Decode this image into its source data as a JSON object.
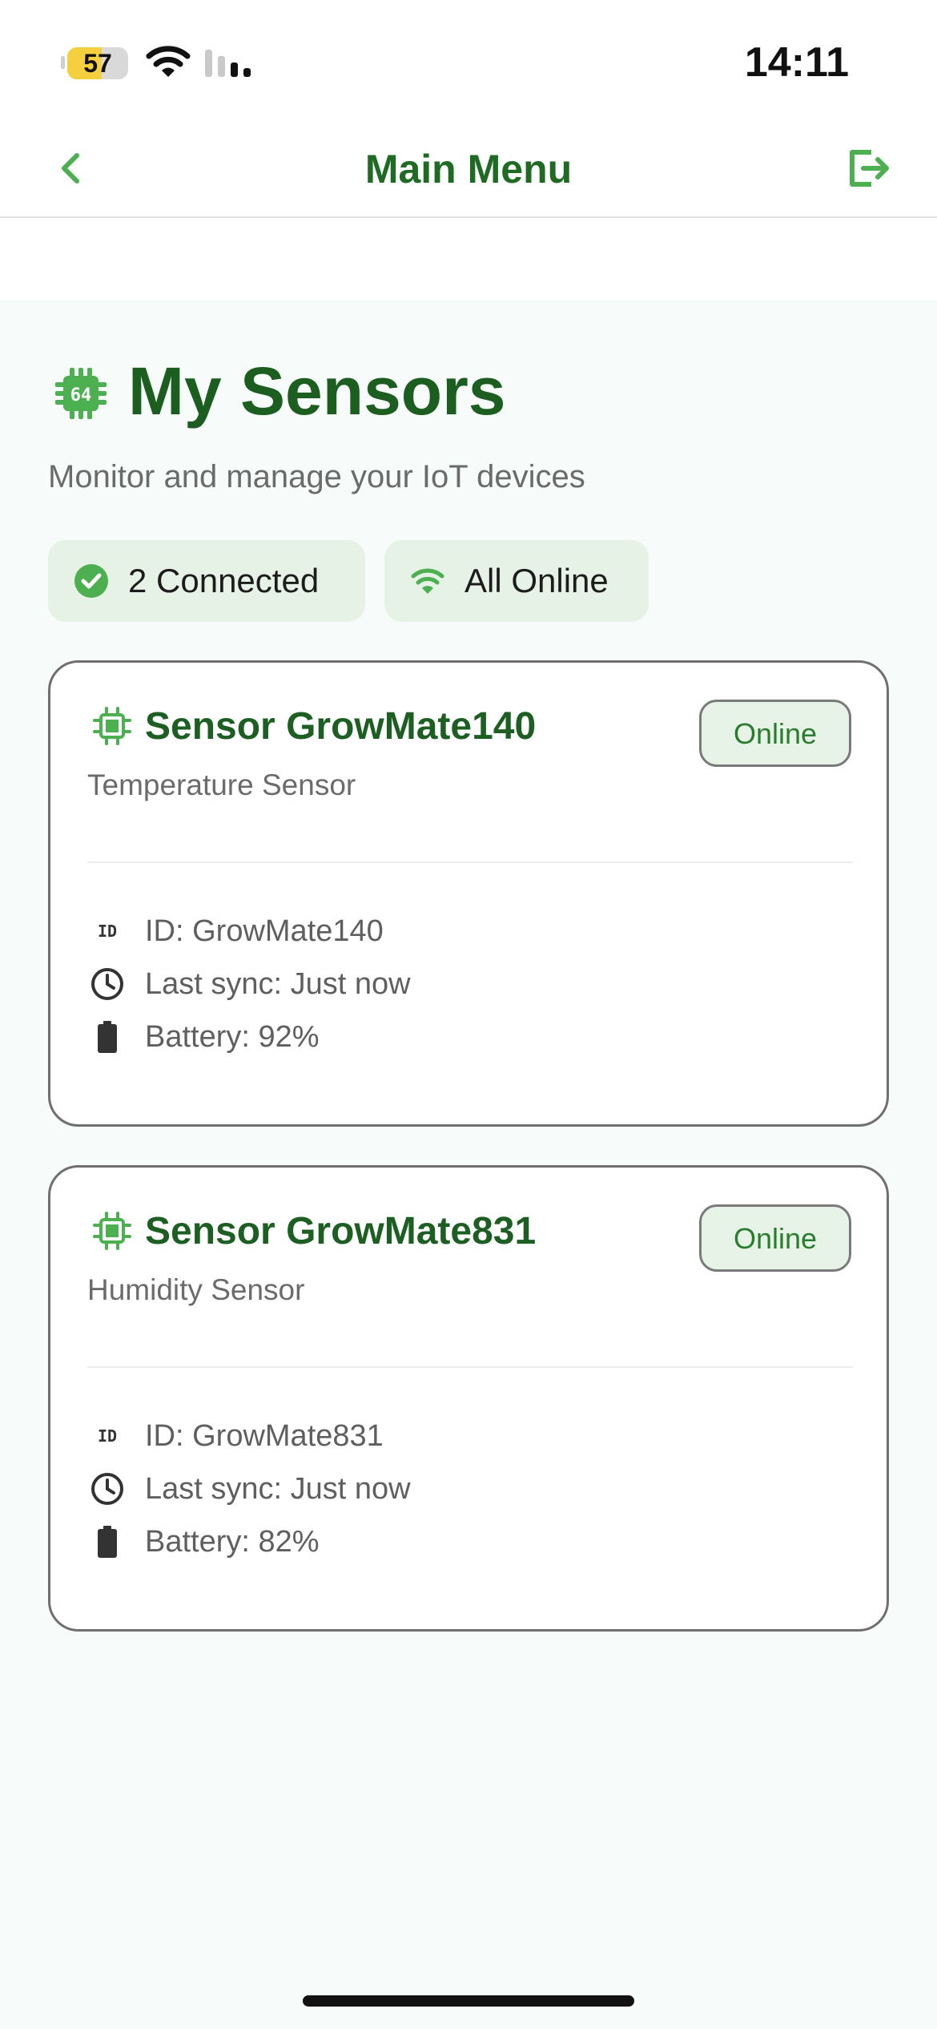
{
  "status_bar": {
    "battery_level": "57",
    "battery_fraction": 0.57,
    "time": "14:11"
  },
  "nav": {
    "back_icon": "chevron-left-icon",
    "title": "Main Menu",
    "logout_icon": "logout-icon"
  },
  "header": {
    "icon": "chip-icon",
    "title": "My Sensors",
    "subtitle": "Monitor and manage your IoT devices"
  },
  "chips": {
    "connected": {
      "icon": "check-circle-icon",
      "label": "2 Connected"
    },
    "online": {
      "icon": "wifi-icon",
      "label": "All Online"
    }
  },
  "sensors": [
    {
      "name": "Sensor GrowMate140",
      "type": "Temperature Sensor",
      "status": "Online",
      "id_text": "ID: GrowMate140",
      "sync_text": "Last sync: Just now",
      "battery_text": "Battery: 92%"
    },
    {
      "name": "Sensor GrowMate831",
      "type": "Humidity Sensor",
      "status": "Online",
      "id_text": "ID: GrowMate831",
      "sync_text": "Last sync: Just now",
      "battery_text": "Battery: 82%"
    }
  ],
  "colors": {
    "primary": "#1b5e20",
    "accent": "#4caf50",
    "chip_bg": "#e6f2e6",
    "badge_bg": "#e8f3e8",
    "battery_yellow": "#f4d03f"
  }
}
